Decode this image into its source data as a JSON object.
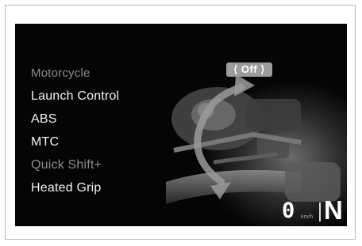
{
  "menu": {
    "header": "Motorcycle",
    "items": [
      {
        "label": "Launch Control"
      },
      {
        "label": "ABS"
      },
      {
        "label": "MTC"
      },
      {
        "label": "Quick Shift+"
      },
      {
        "label": "Heated Grip"
      }
    ]
  },
  "setting": {
    "value": "⟨ Off ⟩"
  },
  "status": {
    "speed": "0",
    "speed_unit": "km/h",
    "gear": "N"
  },
  "icons": [
    "curved-arrow-icon",
    "engine-image"
  ],
  "colors": {
    "screen_bg": "#050505",
    "text": "#f2f2f2",
    "dim_text": "#8c8c8c",
    "badge_bg": "#9c9c9c"
  }
}
